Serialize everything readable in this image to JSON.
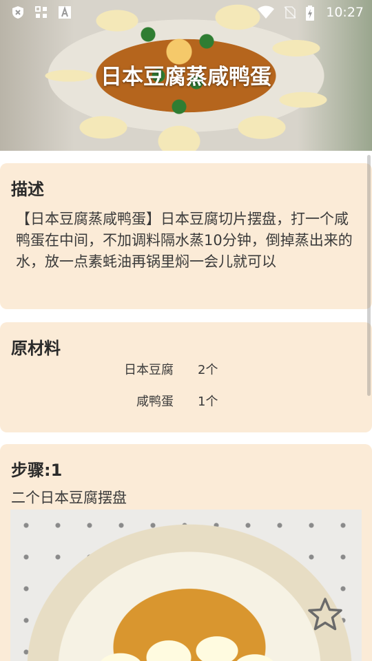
{
  "status_bar": {
    "time": "10:27",
    "left_icons": [
      "shield-x-icon",
      "grid-icon",
      "font-a-icon"
    ],
    "right_icons": [
      "wifi-icon",
      "no-sim-icon",
      "battery-charging-icon"
    ]
  },
  "recipe": {
    "title": "日本豆腐蒸咸鸭蛋"
  },
  "description": {
    "heading": "描述",
    "text": "【日本豆腐蒸咸鸭蛋】日本豆腐切片摆盘，打一个咸鸭蛋在中间，不加调料隔水蒸10分钟，倒掉蒸出来的水，放一点素蚝油再锅里焖一会儿就可以"
  },
  "ingredients": {
    "heading": "原材料",
    "items": [
      {
        "name": "日本豆腐",
        "qty": "2个"
      },
      {
        "name": "咸鸭蛋",
        "qty": "1个"
      }
    ]
  },
  "steps": [
    {
      "heading": "步骤:1",
      "text": "二个日本豆腐摆盘"
    }
  ],
  "colors": {
    "card_bg": "#fbebd7",
    "title_text": "#2a2a2a",
    "body_text": "#3a3a3a"
  },
  "favorite_icon": "star-outline-icon"
}
